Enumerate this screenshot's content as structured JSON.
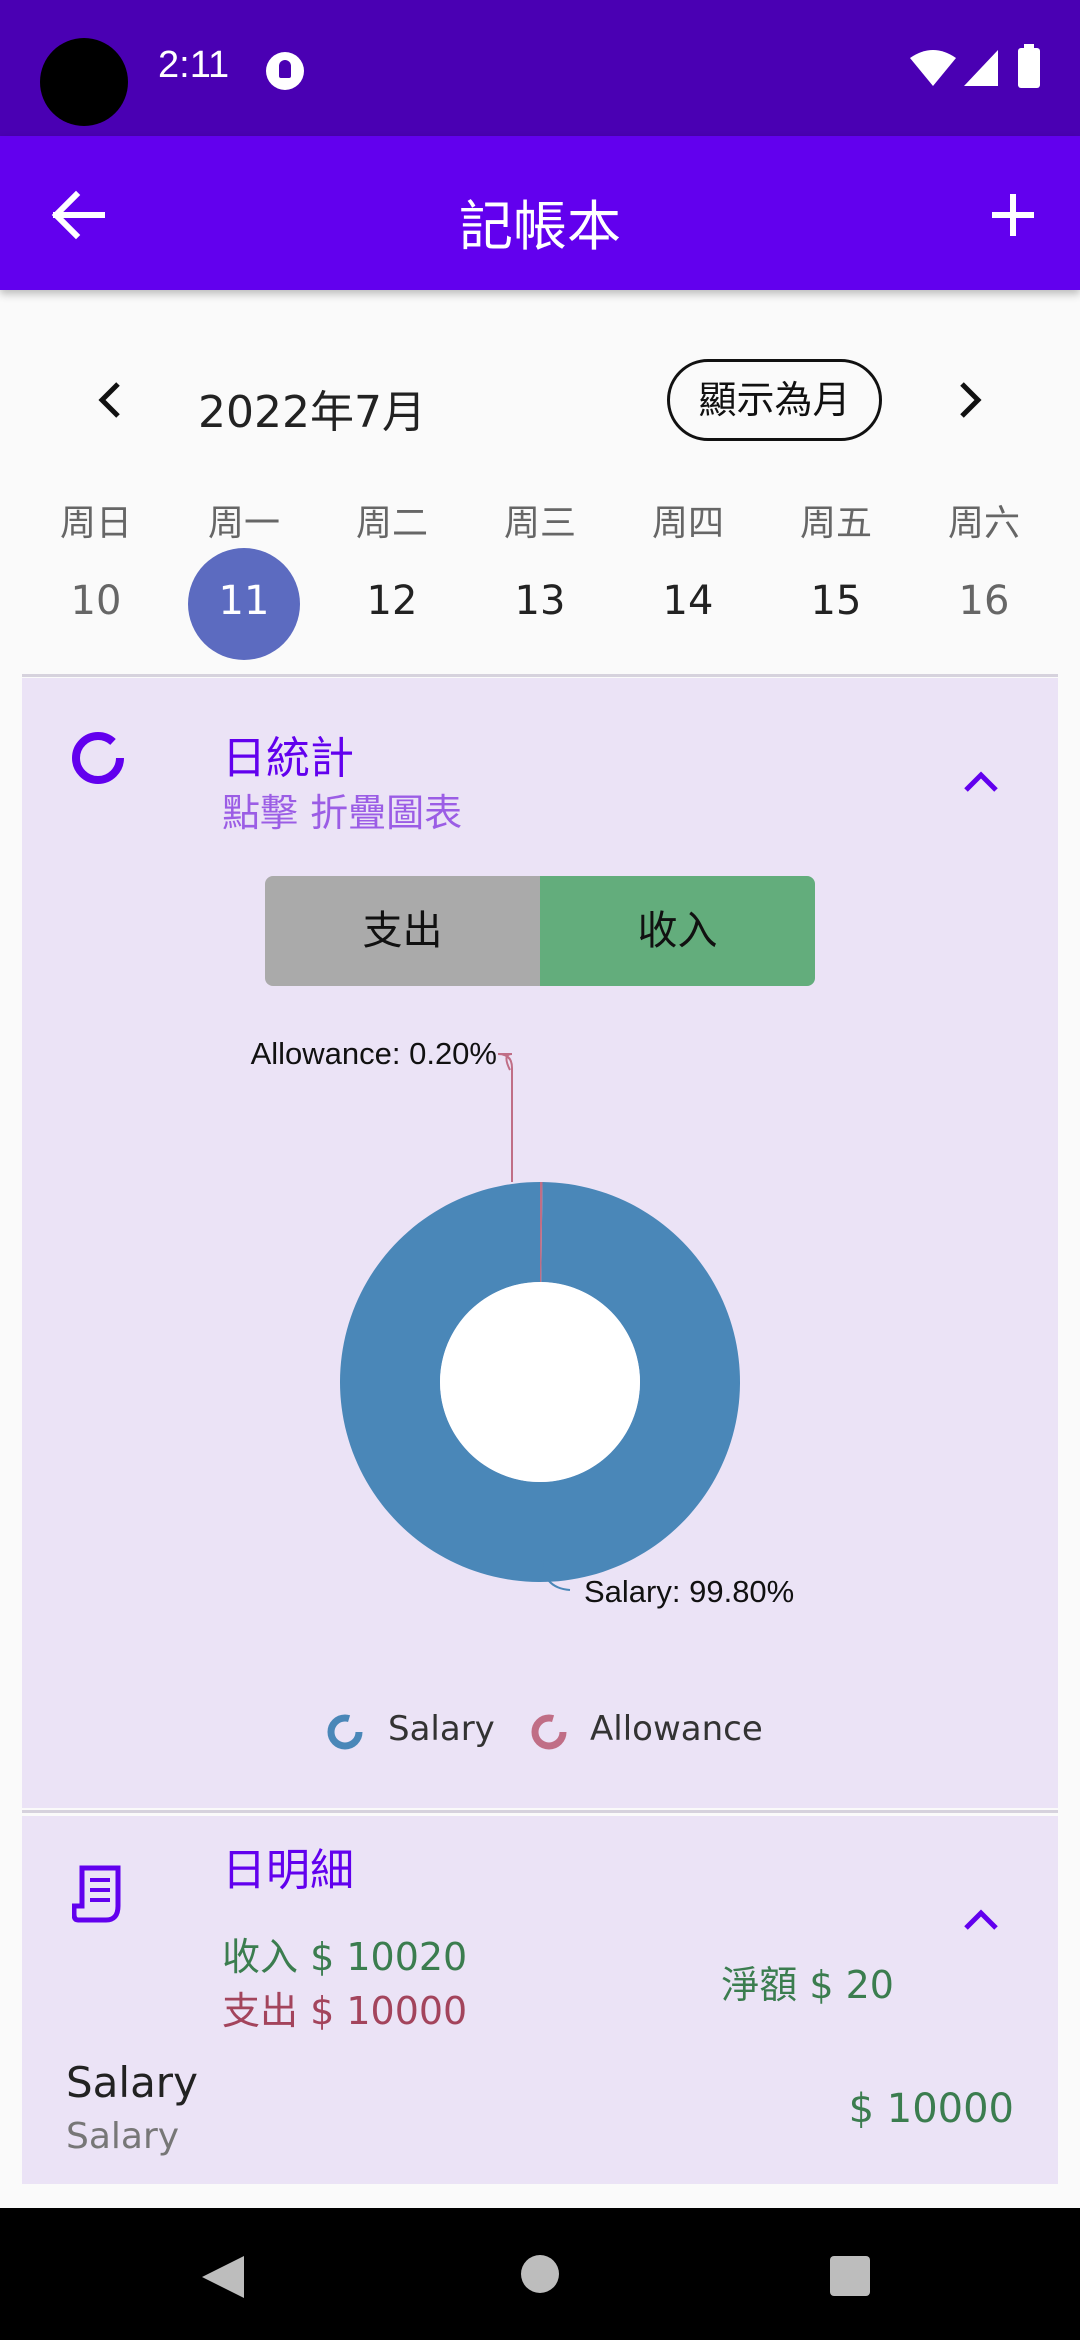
{
  "status_bar": {
    "time": "2:11",
    "icons": [
      "camera-cutout",
      "app-notification-icon",
      "wifi-icon",
      "signal-icon",
      "battery-icon"
    ]
  },
  "app_bar": {
    "title": "記帳本",
    "back_icon": "arrow-left-icon",
    "add_icon": "plus-icon"
  },
  "calendar": {
    "month_label": "2022年7月",
    "toggle_label": "顯示為月",
    "weekdays": [
      "周日",
      "周一",
      "周二",
      "周三",
      "周四",
      "周五",
      "周六"
    ],
    "days": [
      "10",
      "11",
      "12",
      "13",
      "14",
      "15",
      "16"
    ],
    "selected_day": "11",
    "selected_color": "#5c6bc0"
  },
  "stats": {
    "title": "日統計",
    "subtitle": "點擊 折疊圖表",
    "seg_expense": "支出",
    "seg_income": "收入",
    "selected_segment": "收入",
    "accent": "#6200ee",
    "legend": {
      "salary": "Salary",
      "allowance": "Allowance"
    },
    "chart_labels": {
      "allowance": "Allowance: 0.20%",
      "salary": "Salary: 99.80%"
    }
  },
  "chart_data": {
    "type": "pie",
    "categories": [
      "Salary",
      "Allowance"
    ],
    "values": [
      99.8,
      0.2
    ],
    "colors": [
      "#4a87b8",
      "#c06e86"
    ],
    "donut": true,
    "legend_position": "bottom"
  },
  "detail": {
    "title": "日明細",
    "income": "收入 $ 10020",
    "expense": "支出 $ 10000",
    "net": "淨額 $ 20",
    "entries": [
      {
        "title": "Salary",
        "category": "Salary",
        "amount": "$ 10000"
      }
    ]
  },
  "colors": {
    "status_bar": "#4a00b3",
    "app_bar": "#6200ee",
    "card_bg": "#ebe3f6",
    "income_green": "#3b7d4f",
    "expense_red": "#a3445c"
  }
}
